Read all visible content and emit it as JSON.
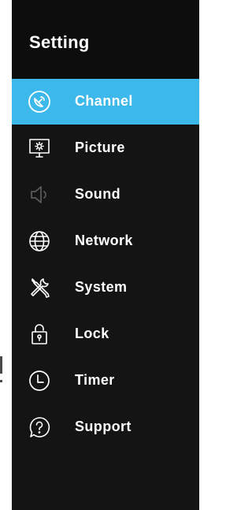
{
  "header": {
    "title": "Setting"
  },
  "menu": {
    "items": [
      {
        "label": "Channel",
        "icon": "satellite-dish-icon",
        "state": "selected"
      },
      {
        "label": "Picture",
        "icon": "picture-monitor-icon",
        "state": "normal"
      },
      {
        "label": "Sound",
        "icon": "speaker-icon",
        "state": "dimmed"
      },
      {
        "label": "Network",
        "icon": "globe-icon",
        "state": "normal"
      },
      {
        "label": "System",
        "icon": "tools-icon",
        "state": "normal"
      },
      {
        "label": "Lock",
        "icon": "lock-icon",
        "state": "normal"
      },
      {
        "label": "Timer",
        "icon": "clock-icon",
        "state": "normal"
      },
      {
        "label": "Support",
        "icon": "help-bubble-icon",
        "state": "normal"
      }
    ]
  },
  "colors": {
    "panel_background": "#141414",
    "header_background": "#0d0d0d",
    "selected_background": "#3cb8ea",
    "text": "#ffffff",
    "dimmed_icon": "#5a5a5a"
  }
}
